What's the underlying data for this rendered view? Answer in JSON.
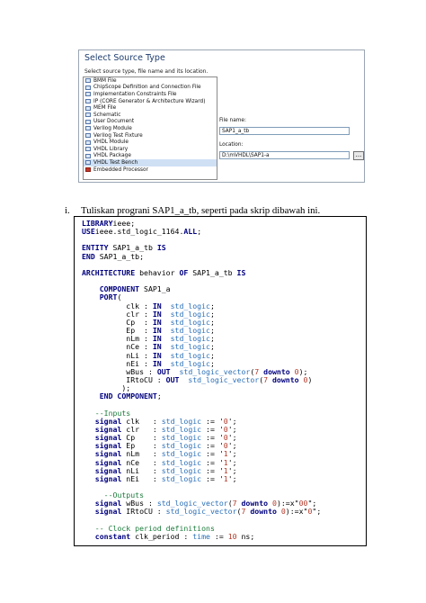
{
  "dialog": {
    "title": "Select Source Type",
    "subtitle": "Select source type, file name and its location.",
    "source_types": [
      "BMM File",
      "ChipScope Definition and Connection File",
      "Implementation Constraints File",
      "IP (CORE Generator & Architecture Wizard)",
      "MEM File",
      "Schematic",
      "User Document",
      "Verilog Module",
      "Verilog Test Fixture",
      "VHDL Module",
      "VHDL Library",
      "VHDL Package",
      "VHDL Test Bench",
      "Embedded Processor"
    ],
    "selected_type": "VHDL Test Bench",
    "file_name_label": "File name:",
    "file_name_value": "SAP1_a_tb",
    "location_label": "Location:",
    "location_value": "D:\\mVHDL\\SAP1-a",
    "browse_label": "..."
  },
  "caption": {
    "number": "i.",
    "text": "Tuliskan prograni SAP1_a_tb, seperti pada skrip dibawah ini."
  },
  "code": {
    "lines": [
      [
        [
          "kw",
          "LIBRARY"
        ],
        [
          "",
          "ieee;"
        ]
      ],
      [
        [
          "kw",
          "USE"
        ],
        [
          "",
          "ieee.std_logic_1164."
        ],
        [
          "kw",
          "ALL"
        ],
        [
          "",
          ";"
        ]
      ],
      [],
      [
        [
          "kw",
          "ENTITY"
        ],
        [
          "",
          " SAP1_a_tb "
        ],
        [
          "kw",
          "IS"
        ]
      ],
      [
        [
          "kw",
          "END"
        ],
        [
          "",
          " SAP1_a_tb;"
        ]
      ],
      [],
      [
        [
          "kw",
          "ARCHITECTURE"
        ],
        [
          "",
          " behavior "
        ],
        [
          "kw",
          "OF"
        ],
        [
          "",
          " SAP1_a_tb "
        ],
        [
          "kw",
          "IS"
        ]
      ],
      [],
      [
        [
          "",
          "    "
        ],
        [
          "kw",
          "COMPONENT"
        ],
        [
          "",
          " SAP1_a"
        ]
      ],
      [
        [
          "",
          "    "
        ],
        [
          "kw",
          "PORT"
        ],
        [
          "",
          "("
        ]
      ],
      [
        [
          "",
          "          clk : "
        ],
        [
          "kw",
          "IN"
        ],
        [
          "ty",
          "  std_logic"
        ],
        [
          "",
          ";"
        ]
      ],
      [
        [
          "",
          "          clr : "
        ],
        [
          "kw",
          "IN"
        ],
        [
          "ty",
          "  std_logic"
        ],
        [
          "",
          ";"
        ]
      ],
      [
        [
          "",
          "          Cp  : "
        ],
        [
          "kw",
          "IN"
        ],
        [
          "ty",
          "  std_logic"
        ],
        [
          "",
          ";"
        ]
      ],
      [
        [
          "",
          "          Ep  : "
        ],
        [
          "kw",
          "IN"
        ],
        [
          "ty",
          "  std_logic"
        ],
        [
          "",
          ";"
        ]
      ],
      [
        [
          "",
          "          nLm : "
        ],
        [
          "kw",
          "IN"
        ],
        [
          "ty",
          "  std_logic"
        ],
        [
          "",
          ";"
        ]
      ],
      [
        [
          "",
          "          nCe : "
        ],
        [
          "kw",
          "IN"
        ],
        [
          "ty",
          "  std_logic"
        ],
        [
          "",
          ";"
        ]
      ],
      [
        [
          "",
          "          nLi : "
        ],
        [
          "kw",
          "IN"
        ],
        [
          "ty",
          "  std_logic"
        ],
        [
          "",
          ";"
        ]
      ],
      [
        [
          "",
          "          nEi : "
        ],
        [
          "kw",
          "IN"
        ],
        [
          "ty",
          "  std_logic"
        ],
        [
          "",
          ";"
        ]
      ],
      [
        [
          "",
          "          wBus : "
        ],
        [
          "kw",
          "OUT"
        ],
        [
          "ty",
          "  std_logic_vector"
        ],
        [
          "",
          "("
        ],
        [
          "nm",
          "7"
        ],
        [
          "kw",
          " downto "
        ],
        [
          "nm",
          "0"
        ],
        [
          "",
          ");"
        ]
      ],
      [
        [
          "",
          "          IRtoCU : "
        ],
        [
          "kw",
          "OUT"
        ],
        [
          "ty",
          "  std_logic_vector"
        ],
        [
          "",
          "("
        ],
        [
          "nm",
          "7"
        ],
        [
          "kw",
          " downto "
        ],
        [
          "nm",
          "0"
        ],
        [
          "",
          ")"
        ]
      ],
      [
        [
          "",
          "         );"
        ]
      ],
      [
        [
          "",
          "    "
        ],
        [
          "kw",
          "END COMPONENT"
        ],
        [
          "",
          ";"
        ]
      ],
      [],
      [
        [
          "",
          "   "
        ],
        [
          "cm",
          "--Inputs"
        ]
      ],
      [
        [
          "",
          "   "
        ],
        [
          "kw",
          "signal"
        ],
        [
          "",
          " clk   : "
        ],
        [
          "ty",
          "std_logic"
        ],
        [
          "",
          " := '"
        ],
        [
          "nm",
          "0"
        ],
        [
          "",
          "';"
        ]
      ],
      [
        [
          "",
          "   "
        ],
        [
          "kw",
          "signal"
        ],
        [
          "",
          " clr   : "
        ],
        [
          "ty",
          "std_logic"
        ],
        [
          "",
          " := '"
        ],
        [
          "nm",
          "0"
        ],
        [
          "",
          "';"
        ]
      ],
      [
        [
          "",
          "   "
        ],
        [
          "kw",
          "signal"
        ],
        [
          "",
          " Cp    : "
        ],
        [
          "ty",
          "std_logic"
        ],
        [
          "",
          " := '"
        ],
        [
          "nm",
          "0"
        ],
        [
          "",
          "';"
        ]
      ],
      [
        [
          "",
          "   "
        ],
        [
          "kw",
          "signal"
        ],
        [
          "",
          " Ep    : "
        ],
        [
          "ty",
          "std_logic"
        ],
        [
          "",
          " := '"
        ],
        [
          "nm",
          "0"
        ],
        [
          "",
          "';"
        ]
      ],
      [
        [
          "",
          "   "
        ],
        [
          "kw",
          "signal"
        ],
        [
          "",
          " nLm   : "
        ],
        [
          "ty",
          "std_logic"
        ],
        [
          "",
          " := '"
        ],
        [
          "nm",
          "1"
        ],
        [
          "",
          "';"
        ]
      ],
      [
        [
          "",
          "   "
        ],
        [
          "kw",
          "signal"
        ],
        [
          "",
          " nCe   : "
        ],
        [
          "ty",
          "std_logic"
        ],
        [
          "",
          " := '"
        ],
        [
          "nm",
          "1"
        ],
        [
          "",
          "';"
        ]
      ],
      [
        [
          "",
          "   "
        ],
        [
          "kw",
          "signal"
        ],
        [
          "",
          " nLi   : "
        ],
        [
          "ty",
          "std_logic"
        ],
        [
          "",
          " := '"
        ],
        [
          "nm",
          "1"
        ],
        [
          "",
          "';"
        ]
      ],
      [
        [
          "",
          "   "
        ],
        [
          "kw",
          "signal"
        ],
        [
          "",
          " nEi   : "
        ],
        [
          "ty",
          "std_logic"
        ],
        [
          "",
          " := '"
        ],
        [
          "nm",
          "1"
        ],
        [
          "",
          "';"
        ]
      ],
      [],
      [
        [
          "",
          "     "
        ],
        [
          "cm",
          "--Outputs"
        ]
      ],
      [
        [
          "",
          "   "
        ],
        [
          "kw",
          "signal"
        ],
        [
          "",
          " wBus : "
        ],
        [
          "ty",
          "std_logic_vector"
        ],
        [
          "",
          "("
        ],
        [
          "nm",
          "7"
        ],
        [
          "kw",
          " downto "
        ],
        [
          "nm",
          "0"
        ],
        [
          "",
          ")"
        ],
        [
          "",
          ":=x\""
        ],
        [
          "nm",
          "00"
        ],
        [
          "",
          "\";"
        ]
      ],
      [
        [
          "",
          "   "
        ],
        [
          "kw",
          "signal"
        ],
        [
          "",
          " IRtoCU : "
        ],
        [
          "ty",
          "std_logic_vector"
        ],
        [
          "",
          "("
        ],
        [
          "nm",
          "7"
        ],
        [
          "kw",
          " downto "
        ],
        [
          "nm",
          "0"
        ],
        [
          "",
          ")"
        ],
        [
          "",
          ":=x\""
        ],
        [
          "nm",
          "0"
        ],
        [
          "",
          "\";"
        ]
      ],
      [],
      [
        [
          "",
          "   "
        ],
        [
          "cm",
          "-- Clock period definitions"
        ]
      ],
      [
        [
          "",
          "   "
        ],
        [
          "kw",
          "constant"
        ],
        [
          "",
          " clk_period : "
        ],
        [
          "ty",
          "time"
        ],
        [
          "",
          " := "
        ],
        [
          "nm",
          "10"
        ],
        [
          "",
          " ns;"
        ]
      ]
    ]
  }
}
